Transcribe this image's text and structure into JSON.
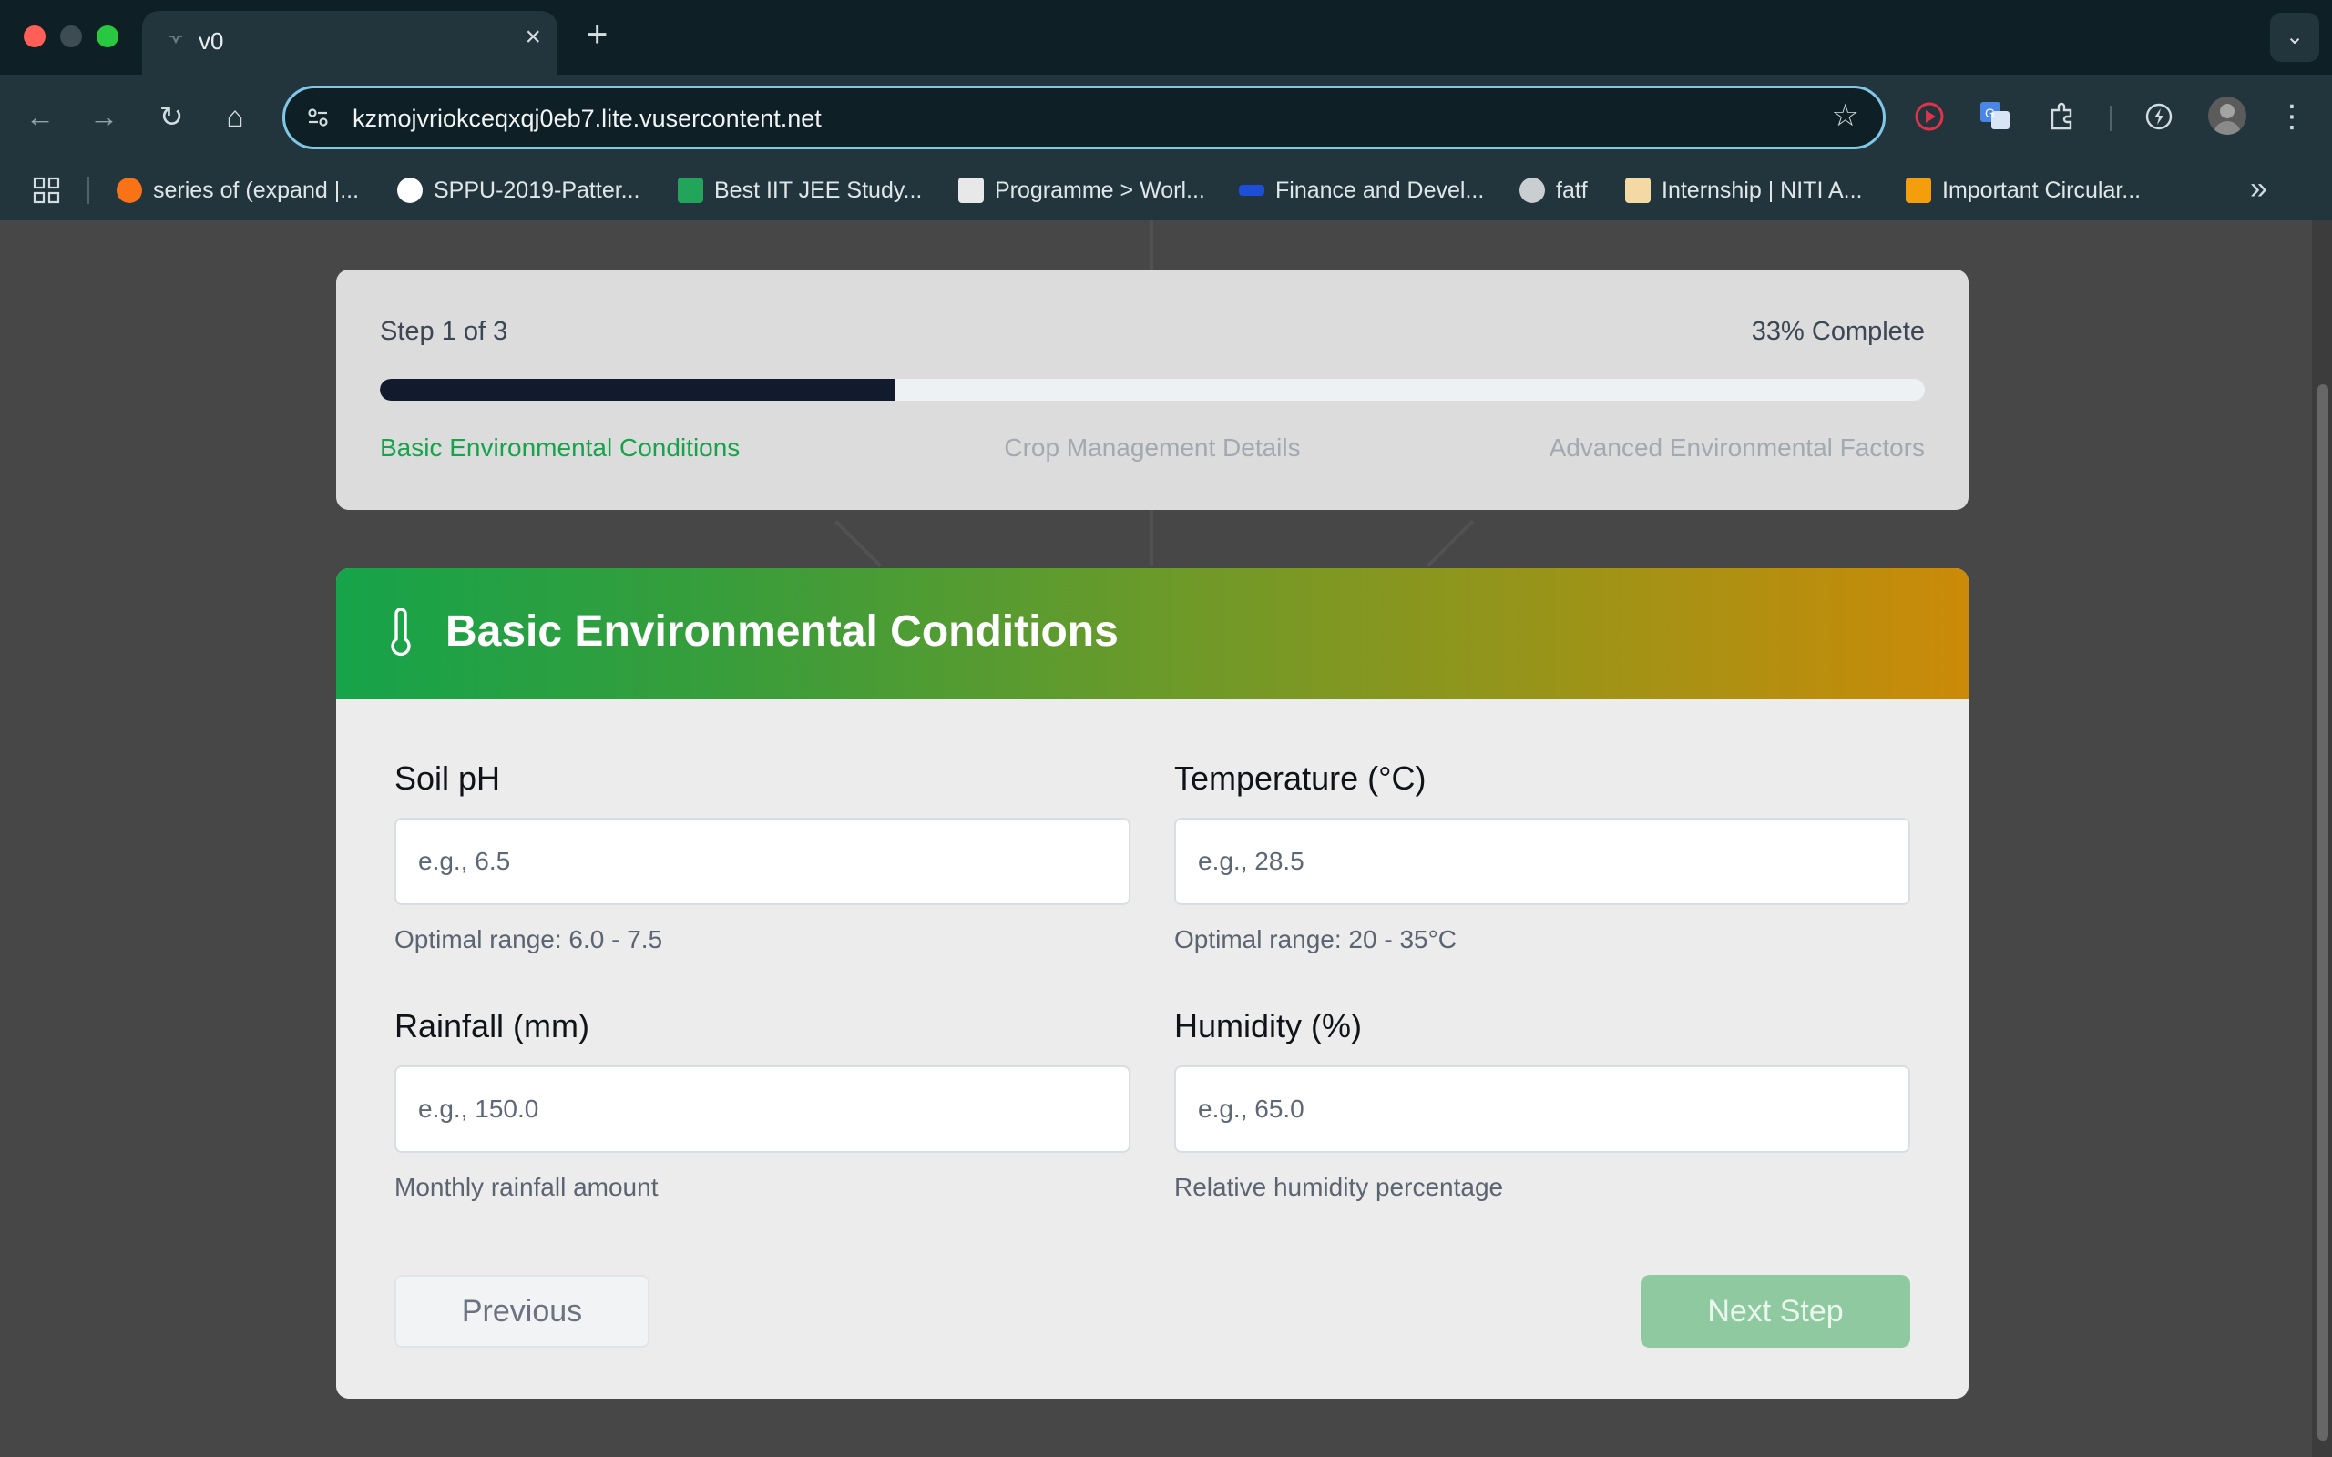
{
  "browser": {
    "tab_title": "v0",
    "url": "kzmojvriokceqxqj0eb7.lite.vusercontent.net",
    "bookmarks": [
      {
        "label": "series of (expand |...",
        "color": "#f97316"
      },
      {
        "label": "SPPU-2019-Patter...",
        "color": "#ffffff"
      },
      {
        "label": "Best IIT JEE Study...",
        "color": "#22a55a"
      },
      {
        "label": "Programme > Worl...",
        "color": "#e8e8e8"
      },
      {
        "label": "Finance and Devel...",
        "color": "#1d4ed8"
      },
      {
        "label": "fatf",
        "color": "#c9ced1"
      },
      {
        "label": "Internship | NITI A...",
        "color": "#f3d9a4"
      },
      {
        "label": "Important Circular...",
        "color": "#f59e0b"
      }
    ]
  },
  "progress": {
    "step_text": "Step 1 of 3",
    "percent_text": "33% Complete",
    "fraction": 0.333,
    "steps": [
      "Basic Environmental Conditions",
      "Crop Management Details",
      "Advanced Environmental Factors"
    ],
    "active_color": "#16a34a"
  },
  "form": {
    "title": "Basic Environmental Conditions",
    "header_gradient": [
      "#16a34a",
      "#ca8a04"
    ],
    "fields": [
      {
        "label": "Soil pH",
        "placeholder": "e.g., 6.5",
        "value": "",
        "hint": "Optimal range: 6.0 - 7.5"
      },
      {
        "label": "Temperature (°C)",
        "placeholder": "e.g., 28.5",
        "value": "",
        "hint": "Optimal range: 20 - 35°C"
      },
      {
        "label": "Rainfall (mm)",
        "placeholder": "e.g., 150.0",
        "value": "",
        "hint": "Monthly rainfall amount"
      },
      {
        "label": "Humidity (%)",
        "placeholder": "e.g., 65.0",
        "value": "",
        "hint": "Relative humidity percentage"
      }
    ],
    "prev_label": "Previous",
    "next_label": "Next Step"
  }
}
